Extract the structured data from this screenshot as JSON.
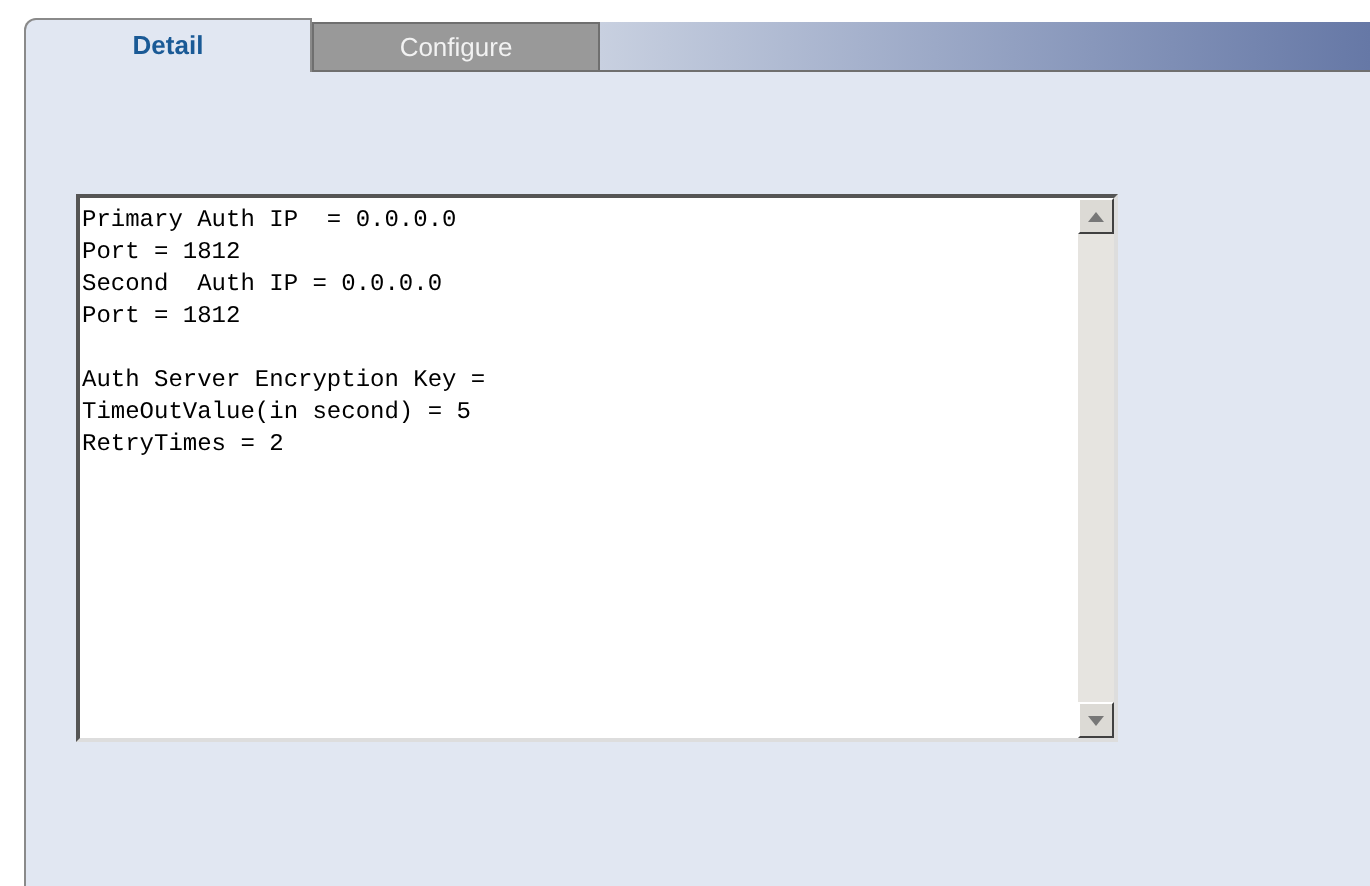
{
  "tabs": [
    {
      "label": "Detail",
      "selected": true
    },
    {
      "label": "Configure",
      "selected": false
    }
  ],
  "detail_text": {
    "groups": [
      [
        "Primary Auth IP  = 0.0.0.0",
        "Port = 1812",
        "Second  Auth IP = 0.0.0.0",
        "Port = 1812"
      ],
      [
        "Auth Server Encryption Key =",
        "TimeOutValue(in second) = 5",
        "RetryTimes = 2"
      ]
    ]
  }
}
